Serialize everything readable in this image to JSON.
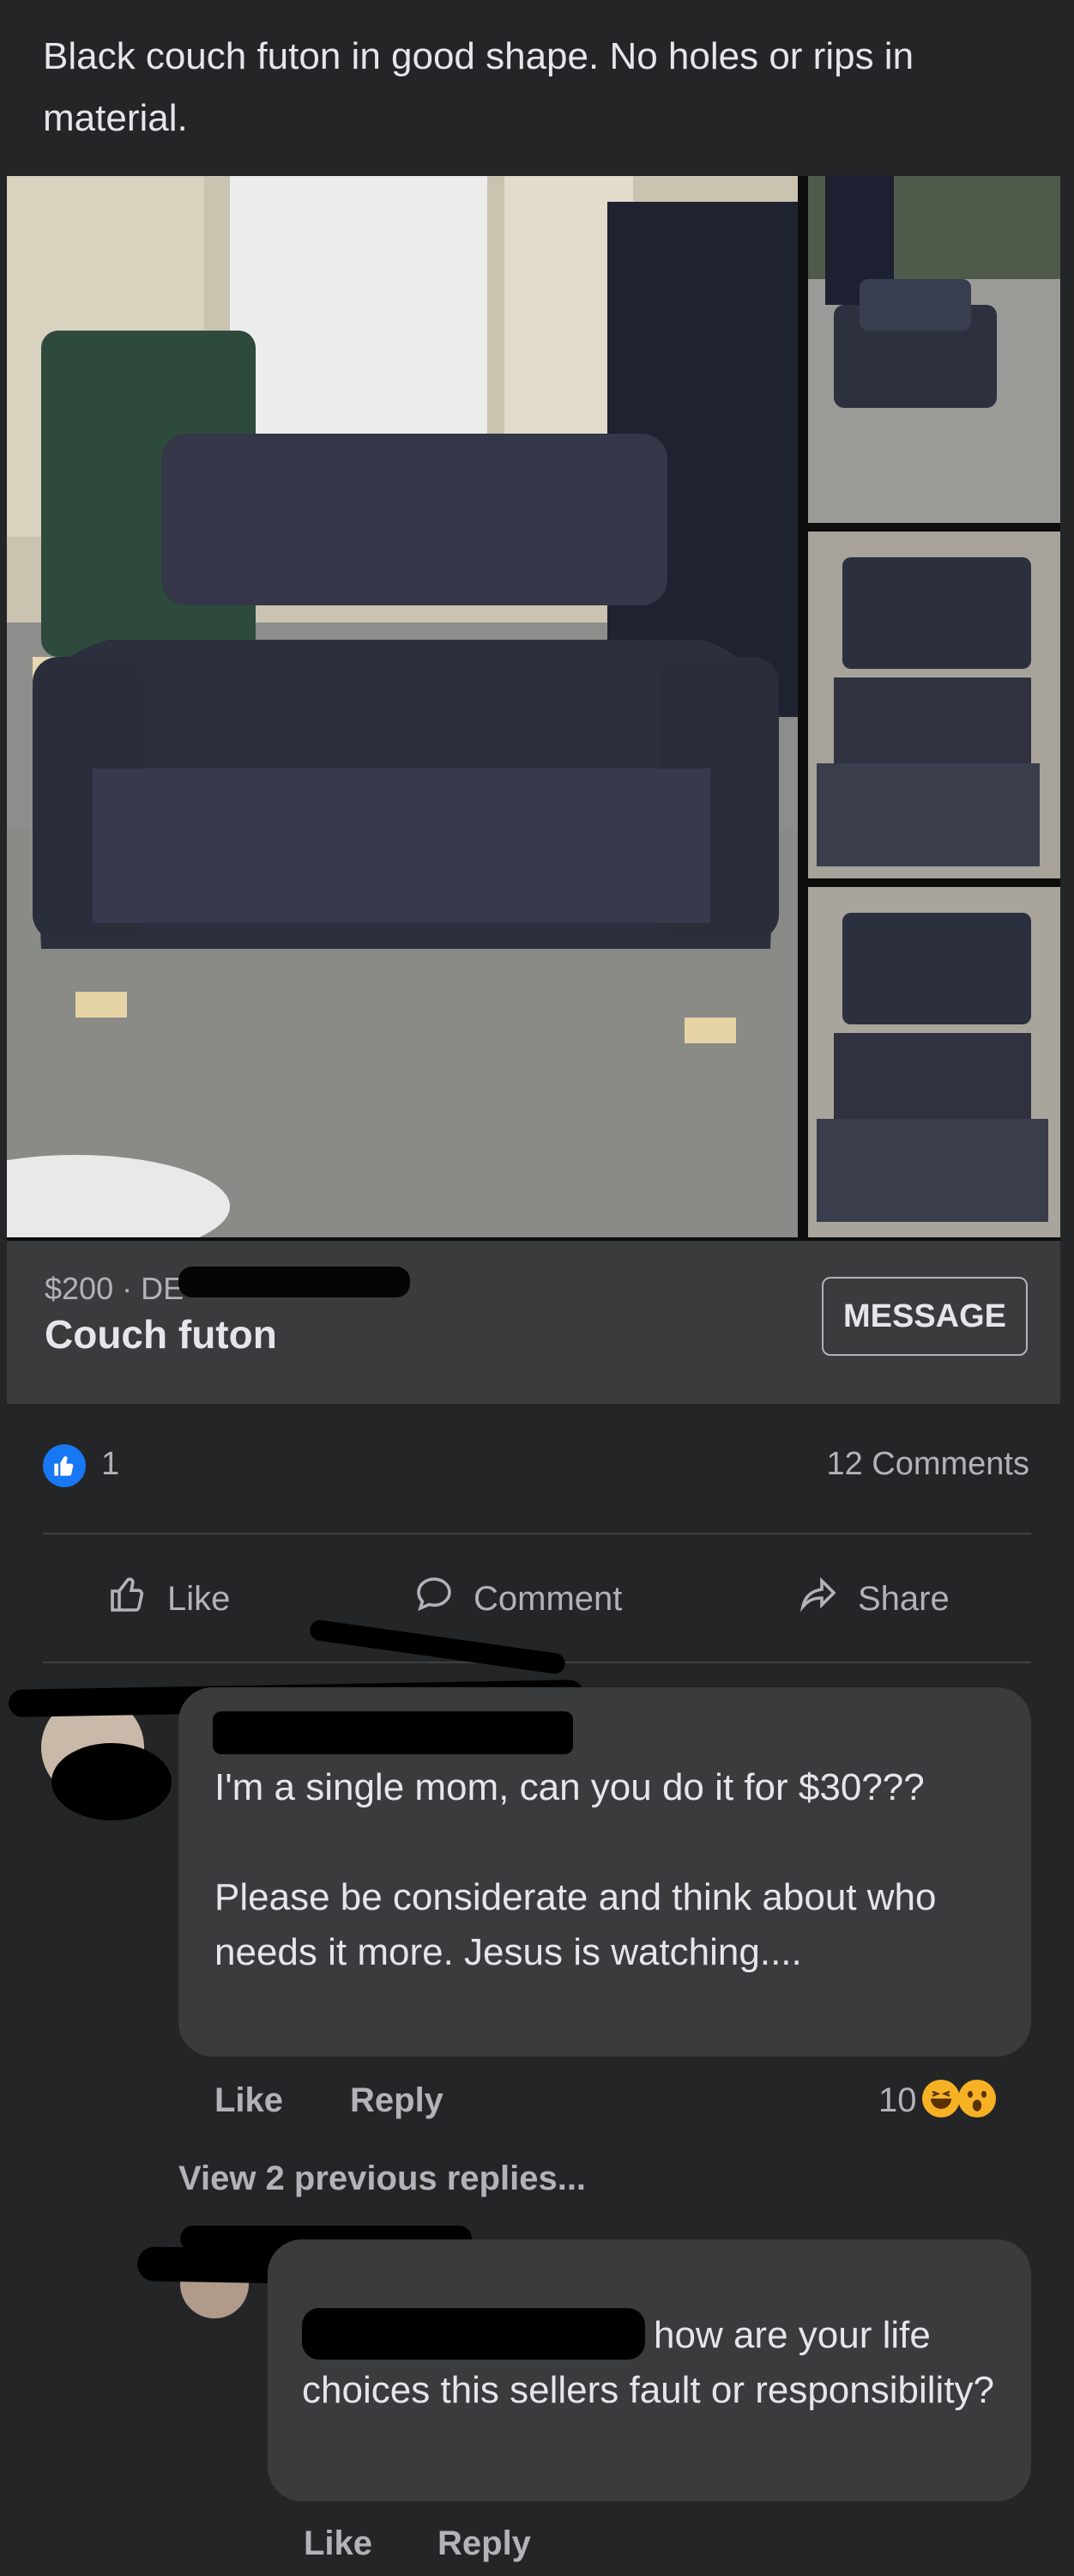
{
  "post": {
    "text": "Black couch futon in good shape. No holes or rips in material."
  },
  "listing": {
    "price": "$200 · DE",
    "title": "Couch futon",
    "message_button": "MESSAGE"
  },
  "reactions": {
    "like_count": "1",
    "comments_count": "12 Comments"
  },
  "actions": {
    "like": "Like",
    "comment": "Comment",
    "share": "Share"
  },
  "comment1": {
    "line1": "I'm a single mom, can you do it for $30???",
    "line2": "Please be considerate and think about who needs it more. Jesus is watching....",
    "like": "Like",
    "reply": "Reply",
    "reaction_count": "10"
  },
  "view_replies": "View 2 previous replies...",
  "comment2": {
    "text": "how are your life choices this sellers fault or responsibility?",
    "like": "Like",
    "reply": "Reply"
  },
  "colors": {
    "background": "#242526",
    "bubble": "#3a3b3c",
    "accent": "#1877f2",
    "text": "#e4e6eb",
    "muted": "#b0b3b8"
  }
}
